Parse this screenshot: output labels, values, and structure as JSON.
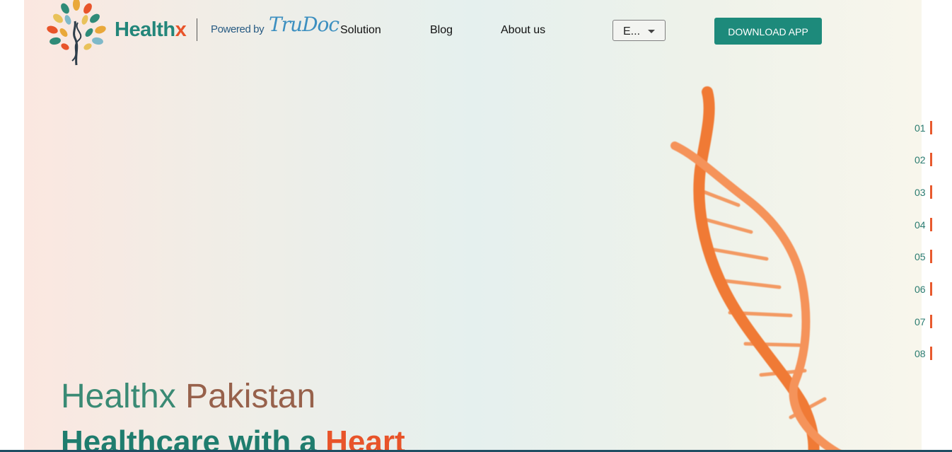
{
  "header": {
    "brand_main": "Health",
    "brand_accent": "x",
    "powered_by": "Powered by",
    "partner_logo_text": "TruDoc",
    "nav": [
      {
        "label": "Solution"
      },
      {
        "label": "Blog"
      },
      {
        "label": "About us"
      }
    ],
    "language_select": {
      "value": "E..."
    },
    "download_button": "DOWNLOAD APP"
  },
  "slide_indicators": [
    "01",
    "02",
    "03",
    "04",
    "05",
    "06",
    "07",
    "08"
  ],
  "hero": {
    "title_part1": "Healthx",
    "title_part2": "Pakistan",
    "subtitle_main": "Healthcare with a ",
    "subtitle_accent": "Heart"
  },
  "colors": {
    "brand_teal": "#1d8a7b",
    "brand_orange": "#e8542a",
    "indicator_bar": "#e85a2e",
    "dna": "#f08040"
  }
}
